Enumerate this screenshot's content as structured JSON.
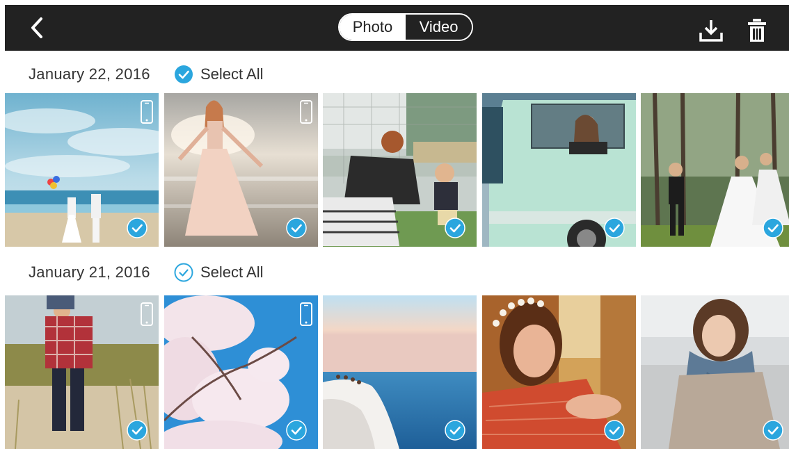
{
  "header": {
    "back_icon": "chevron-left-icon",
    "tabs": [
      {
        "label": "Photo",
        "active": true
      },
      {
        "label": "Video",
        "active": false
      }
    ],
    "download_icon": "download-icon",
    "delete_icon": "trash-icon"
  },
  "groups": [
    {
      "date": "January 22, 2016",
      "select_all_label": "Select All",
      "select_all_checked": true,
      "photos": [
        {
          "subject": "couple on beach with balloons",
          "phone_badge": true,
          "selected": true
        },
        {
          "subject": "woman in dress on beach",
          "phone_badge": true,
          "selected": true
        },
        {
          "subject": "mother and child on grass",
          "phone_badge": false,
          "selected": true
        },
        {
          "subject": "woman in vintage van",
          "phone_badge": false,
          "selected": true
        },
        {
          "subject": "wedding party in forest",
          "phone_badge": false,
          "selected": true
        }
      ]
    },
    {
      "date": "January 21, 2016",
      "select_all_label": "Select All",
      "select_all_checked": false,
      "photos": [
        {
          "subject": "man carrying child on shoulders",
          "phone_badge": true,
          "selected": true
        },
        {
          "subject": "cherry blossoms against sky",
          "phone_badge": true,
          "selected": true
        },
        {
          "subject": "people on cliff by sea",
          "phone_badge": false,
          "selected": true
        },
        {
          "subject": "woman with flower crown",
          "phone_badge": false,
          "selected": true
        },
        {
          "subject": "woman with scarf",
          "phone_badge": false,
          "selected": true
        }
      ]
    }
  ],
  "colors": {
    "accent": "#2ba6de",
    "topbar": "#222222",
    "text": "#333333"
  }
}
